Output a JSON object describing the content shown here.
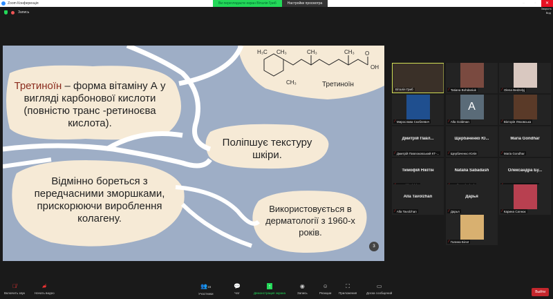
{
  "window": {
    "title": "Zoom Конференція",
    "banner": "Ви переглядаєте екран Віталія Гриб",
    "view_options": "Настройки просмотра",
    "close_tooltip": "Закрыть",
    "view_label": "Вид",
    "recording": "Запись"
  },
  "slide": {
    "chem_label": "Третиноїн",
    "chem_atoms": {
      "h3c": "H3C",
      "ch3a": "CH3",
      "ch3b": "CH3",
      "ch3c": "CH3",
      "ch3d": "CH3",
      "o": "O",
      "oh": "OH"
    },
    "block1_title": "Третиноїн",
    "block1_rest": " – форма вітаміну А у вигляді карбонової кислоти (повністю транс -ретиноєва кислота).",
    "block2": "Поліпшує текстуру шкіри.",
    "block3": "Відмінно бореться з передчасними зморшками, прискорюючи вироблення колагену.",
    "block4": "Використовується в дерматології з 1960-х років.",
    "page": "3"
  },
  "participants": [
    {
      "name": "Віталія Гриб",
      "video": true,
      "active": true,
      "color": "#3a3028"
    },
    {
      "name": "Tatiana Bohdaniuk",
      "video": true,
      "color": "#7a4a40"
    },
    {
      "name": "Olena Bedzelyj",
      "video": true,
      "color": "#d9c8c0"
    },
    {
      "name": "Мирослава Скоблевич",
      "video": true,
      "color": "#1f4f8f"
    },
    {
      "name": "Alla Goldman",
      "avatar": "A",
      "color": "#5a6b78"
    },
    {
      "name": "Вікторія Ляховська",
      "video": true,
      "color": "#5a3a28"
    },
    {
      "name": "Дмитрій Павлоковський КТ-...",
      "display": "Дмитрій Павл..."
    },
    {
      "name": "Щербаченко Юлія",
      "display": "Щербаченко Ю..."
    },
    {
      "name": "Maria Gondhar",
      "display": "Maria Gondhar"
    },
    {
      "name": "Тимофій Нікітін",
      "display": "Тимофій Нікітін"
    },
    {
      "name": "Natalia Sabadash",
      "display": "Natalia Sabadash"
    },
    {
      "name": "Олександра Будьянова",
      "display": "Олександра Бу..."
    },
    {
      "name": "Alla Tavolzhan",
      "display": "Alla Tavolzhan"
    },
    {
      "name": "Дарья",
      "display": "Дарья"
    },
    {
      "name": "Карина Сагнюк",
      "video": true,
      "color": "#b84050"
    },
    {
      "name": "Галина Білої",
      "video": true,
      "color": "#d8b070"
    }
  ],
  "toolbar": {
    "mute": "Включить звук",
    "video": "Начать видео",
    "participants": "Участники",
    "participants_count": "16",
    "chat": "Чат",
    "share": "Демонстрация экрана",
    "record": "Запись",
    "reactions": "Реакции",
    "apps": "Приложения",
    "whiteboard": "Доска сообщений",
    "leave": "Выйти"
  },
  "colors": {
    "slide_bg": "#9eaec6",
    "blob": "#f6ead6",
    "share_green": "#23d959",
    "leave_red": "#c4272d"
  }
}
